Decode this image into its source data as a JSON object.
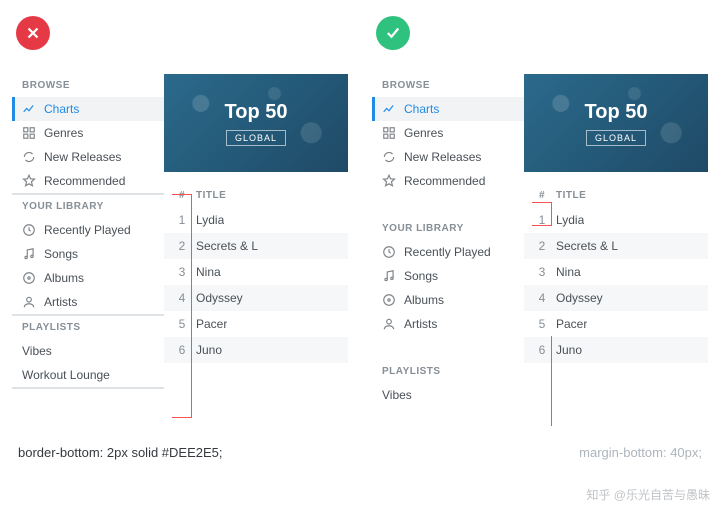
{
  "badges": {
    "bad": "✕",
    "good": "✓"
  },
  "sidebar": {
    "sections": [
      {
        "label": "BROWSE",
        "items": [
          {
            "label": "Charts",
            "icon": "chart",
            "active": true
          },
          {
            "label": "Genres",
            "icon": "grid"
          },
          {
            "label": "New Releases",
            "icon": "refresh"
          },
          {
            "label": "Recommended",
            "icon": "star"
          }
        ]
      },
      {
        "label": "YOUR LIBRARY",
        "items": [
          {
            "label": "Recently Played",
            "icon": "clock"
          },
          {
            "label": "Songs",
            "icon": "music"
          },
          {
            "label": "Albums",
            "icon": "disc"
          },
          {
            "label": "Artists",
            "icon": "user"
          }
        ]
      },
      {
        "label": "PLAYLISTS",
        "plain_items": [
          "Vibes",
          "Workout Lounge"
        ]
      }
    ]
  },
  "content": {
    "cover_title": "Top 50",
    "cover_sub": "GLOBAL",
    "columns": [
      "#",
      "TITLE"
    ],
    "rows": [
      {
        "n": 1,
        "title": "Lydia"
      },
      {
        "n": 2,
        "title": "Secrets & L"
      },
      {
        "n": 3,
        "title": "Nina"
      },
      {
        "n": 4,
        "title": "Odyssey"
      },
      {
        "n": 5,
        "title": "Pacer"
      },
      {
        "n": 6,
        "title": "Juno"
      }
    ]
  },
  "code": {
    "left": "border-bottom: 2px solid #DEE2E5;",
    "right": "margin-bottom: 40px;"
  },
  "watermark": "知乎 @乐光自苦与愚昧"
}
